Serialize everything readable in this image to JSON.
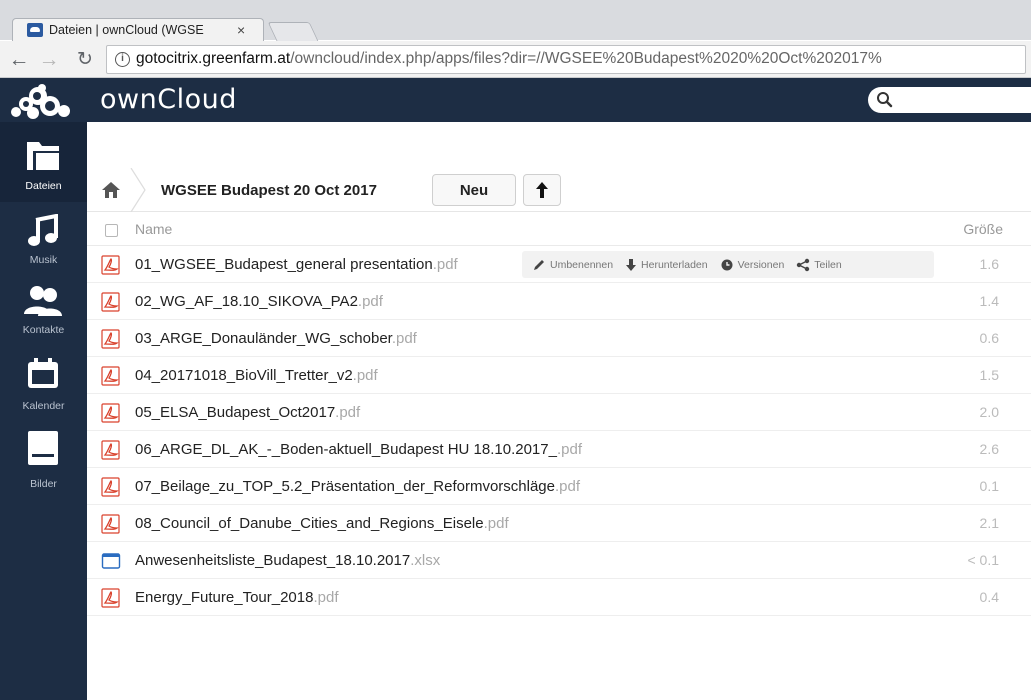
{
  "browser": {
    "tab_title": "Dateien | ownCloud (WGSE",
    "tab_close": "×",
    "url_host": "gotocitrix.greenfarm.at",
    "url_path": "/owncloud/index.php/apps/files?dir=//WGSEE%20Budapest%2020%20Oct%202017%"
  },
  "header": {
    "brand": "ownCloud",
    "search_placeholder": ""
  },
  "nav": {
    "items": [
      {
        "label": "Dateien",
        "icon": "folder-icon"
      },
      {
        "label": "Musik",
        "icon": "music-icon"
      },
      {
        "label": "Kontakte",
        "icon": "contacts-icon"
      },
      {
        "label": "Kalender",
        "icon": "calendar-icon"
      },
      {
        "label": "Bilder",
        "icon": "pictures-icon"
      }
    ]
  },
  "breadcrumb": {
    "current": "WGSEE Budapest 20 Oct 2017"
  },
  "controls": {
    "new_label": "Neu"
  },
  "table": {
    "col_name": "Name",
    "col_size": "Größe"
  },
  "row_actions": {
    "rename": "Umbenennen",
    "download": "Herunterladen",
    "versions": "Versionen",
    "share": "Teilen"
  },
  "files": [
    {
      "base": "01_WGSEE_Budapest_general presentation",
      "ext": ".pdf",
      "size": "1.6",
      "type": "pdf"
    },
    {
      "base": "02_WG_AF_18.10_SIKOVA_PA2",
      "ext": ".pdf",
      "size": "1.4",
      "type": "pdf"
    },
    {
      "base": "03_ARGE_Donauländer_WG_schober",
      "ext": ".pdf",
      "size": "0.6",
      "type": "pdf"
    },
    {
      "base": "04_20171018_BioVill_Tretter_v2",
      "ext": ".pdf",
      "size": "1.5",
      "type": "pdf"
    },
    {
      "base": "05_ELSA_Budapest_Oct2017",
      "ext": ".pdf",
      "size": "2.0",
      "type": "pdf"
    },
    {
      "base": "06_ARGE_DL_AK_-_Boden-aktuell_Budapest HU 18.10.2017_",
      "ext": ".pdf",
      "size": "2.6",
      "type": "pdf"
    },
    {
      "base": "07_Beilage_zu_TOP_5.2_Präsentation_der_Reformvorschläge",
      "ext": ".pdf",
      "size": "0.1",
      "type": "pdf"
    },
    {
      "base": "08_Council_of_Danube_Cities_and_Regions_Eisele",
      "ext": ".pdf",
      "size": "2.1",
      "type": "pdf"
    },
    {
      "base": "Anwesenheitsliste_Budapest_18.10.2017",
      "ext": ".xlsx",
      "size": "< 0.1",
      "type": "xlsx"
    },
    {
      "base": "Energy_Future_Tour_2018",
      "ext": ".pdf",
      "size": "0.4",
      "type": "pdf"
    }
  ],
  "colors": {
    "header_bg": "#1d2d44",
    "pdf_red": "#d9412c",
    "xlsx_blue": "#2a6cc0"
  }
}
